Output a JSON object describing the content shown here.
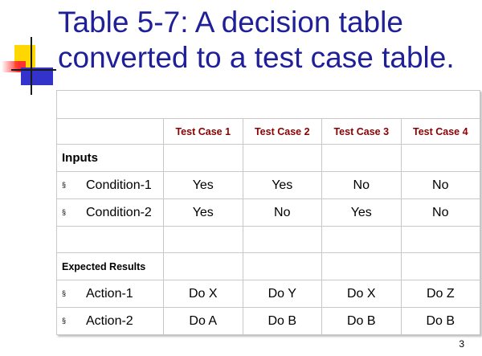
{
  "slide": {
    "title": "Table 5-7: A decision table converted to a test case table.",
    "page_number": "3"
  },
  "table": {
    "columns": [
      "Test Case 1",
      "Test Case 2",
      "Test Case 3",
      "Test Case 4"
    ],
    "inputs_label": "Inputs",
    "expected_label": "Expected Results",
    "bullet": "§",
    "conditions": [
      {
        "label": "Condition-1",
        "values": [
          "Yes",
          "Yes",
          "No",
          "No"
        ]
      },
      {
        "label": "Condition-2",
        "values": [
          "Yes",
          "No",
          "Yes",
          "No"
        ]
      }
    ],
    "actions": [
      {
        "label": "Action-1",
        "values": [
          "Do X",
          "Do Y",
          "Do X",
          "Do Z"
        ]
      },
      {
        "label": "Action-2",
        "values": [
          "Do A",
          "Do B",
          "Do B",
          "Do B"
        ]
      }
    ]
  },
  "colors": {
    "title": "#1f1f99",
    "header": "#8b0000",
    "accent_yellow": "#ffd700",
    "accent_red": "#ff3030",
    "accent_blue": "#3333cc"
  }
}
